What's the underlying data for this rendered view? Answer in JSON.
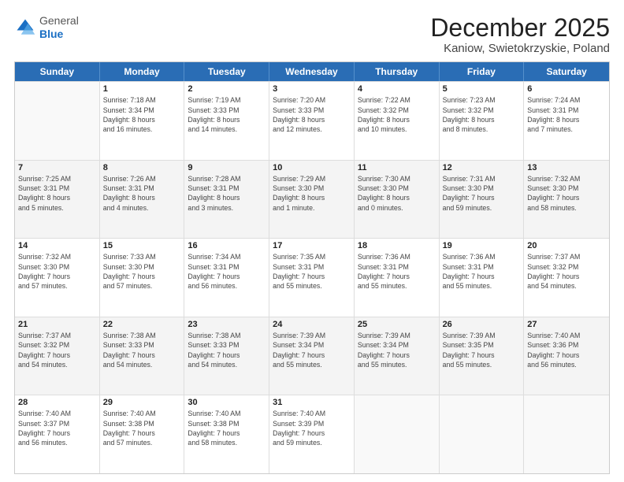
{
  "header": {
    "logo": {
      "general": "General",
      "blue": "Blue"
    },
    "title": "December 2025",
    "subtitle": "Kaniow, Swietokrzyskie, Poland"
  },
  "weekdays": [
    "Sunday",
    "Monday",
    "Tuesday",
    "Wednesday",
    "Thursday",
    "Friday",
    "Saturday"
  ],
  "rows": [
    [
      {
        "day": "",
        "info": ""
      },
      {
        "day": "1",
        "info": "Sunrise: 7:18 AM\nSunset: 3:34 PM\nDaylight: 8 hours\nand 16 minutes."
      },
      {
        "day": "2",
        "info": "Sunrise: 7:19 AM\nSunset: 3:33 PM\nDaylight: 8 hours\nand 14 minutes."
      },
      {
        "day": "3",
        "info": "Sunrise: 7:20 AM\nSunset: 3:33 PM\nDaylight: 8 hours\nand 12 minutes."
      },
      {
        "day": "4",
        "info": "Sunrise: 7:22 AM\nSunset: 3:32 PM\nDaylight: 8 hours\nand 10 minutes."
      },
      {
        "day": "5",
        "info": "Sunrise: 7:23 AM\nSunset: 3:32 PM\nDaylight: 8 hours\nand 8 minutes."
      },
      {
        "day": "6",
        "info": "Sunrise: 7:24 AM\nSunset: 3:31 PM\nDaylight: 8 hours\nand 7 minutes."
      }
    ],
    [
      {
        "day": "7",
        "info": "Sunrise: 7:25 AM\nSunset: 3:31 PM\nDaylight: 8 hours\nand 5 minutes."
      },
      {
        "day": "8",
        "info": "Sunrise: 7:26 AM\nSunset: 3:31 PM\nDaylight: 8 hours\nand 4 minutes."
      },
      {
        "day": "9",
        "info": "Sunrise: 7:28 AM\nSunset: 3:31 PM\nDaylight: 8 hours\nand 3 minutes."
      },
      {
        "day": "10",
        "info": "Sunrise: 7:29 AM\nSunset: 3:30 PM\nDaylight: 8 hours\nand 1 minute."
      },
      {
        "day": "11",
        "info": "Sunrise: 7:30 AM\nSunset: 3:30 PM\nDaylight: 8 hours\nand 0 minutes."
      },
      {
        "day": "12",
        "info": "Sunrise: 7:31 AM\nSunset: 3:30 PM\nDaylight: 7 hours\nand 59 minutes."
      },
      {
        "day": "13",
        "info": "Sunrise: 7:32 AM\nSunset: 3:30 PM\nDaylight: 7 hours\nand 58 minutes."
      }
    ],
    [
      {
        "day": "14",
        "info": "Sunrise: 7:32 AM\nSunset: 3:30 PM\nDaylight: 7 hours\nand 57 minutes."
      },
      {
        "day": "15",
        "info": "Sunrise: 7:33 AM\nSunset: 3:30 PM\nDaylight: 7 hours\nand 57 minutes."
      },
      {
        "day": "16",
        "info": "Sunrise: 7:34 AM\nSunset: 3:31 PM\nDaylight: 7 hours\nand 56 minutes."
      },
      {
        "day": "17",
        "info": "Sunrise: 7:35 AM\nSunset: 3:31 PM\nDaylight: 7 hours\nand 55 minutes."
      },
      {
        "day": "18",
        "info": "Sunrise: 7:36 AM\nSunset: 3:31 PM\nDaylight: 7 hours\nand 55 minutes."
      },
      {
        "day": "19",
        "info": "Sunrise: 7:36 AM\nSunset: 3:31 PM\nDaylight: 7 hours\nand 55 minutes."
      },
      {
        "day": "20",
        "info": "Sunrise: 7:37 AM\nSunset: 3:32 PM\nDaylight: 7 hours\nand 54 minutes."
      }
    ],
    [
      {
        "day": "21",
        "info": "Sunrise: 7:37 AM\nSunset: 3:32 PM\nDaylight: 7 hours\nand 54 minutes."
      },
      {
        "day": "22",
        "info": "Sunrise: 7:38 AM\nSunset: 3:33 PM\nDaylight: 7 hours\nand 54 minutes."
      },
      {
        "day": "23",
        "info": "Sunrise: 7:38 AM\nSunset: 3:33 PM\nDaylight: 7 hours\nand 54 minutes."
      },
      {
        "day": "24",
        "info": "Sunrise: 7:39 AM\nSunset: 3:34 PM\nDaylight: 7 hours\nand 55 minutes."
      },
      {
        "day": "25",
        "info": "Sunrise: 7:39 AM\nSunset: 3:34 PM\nDaylight: 7 hours\nand 55 minutes."
      },
      {
        "day": "26",
        "info": "Sunrise: 7:39 AM\nSunset: 3:35 PM\nDaylight: 7 hours\nand 55 minutes."
      },
      {
        "day": "27",
        "info": "Sunrise: 7:40 AM\nSunset: 3:36 PM\nDaylight: 7 hours\nand 56 minutes."
      }
    ],
    [
      {
        "day": "28",
        "info": "Sunrise: 7:40 AM\nSunset: 3:37 PM\nDaylight: 7 hours\nand 56 minutes."
      },
      {
        "day": "29",
        "info": "Sunrise: 7:40 AM\nSunset: 3:38 PM\nDaylight: 7 hours\nand 57 minutes."
      },
      {
        "day": "30",
        "info": "Sunrise: 7:40 AM\nSunset: 3:38 PM\nDaylight: 7 hours\nand 58 minutes."
      },
      {
        "day": "31",
        "info": "Sunrise: 7:40 AM\nSunset: 3:39 PM\nDaylight: 7 hours\nand 59 minutes."
      },
      {
        "day": "",
        "info": ""
      },
      {
        "day": "",
        "info": ""
      },
      {
        "day": "",
        "info": ""
      }
    ]
  ]
}
